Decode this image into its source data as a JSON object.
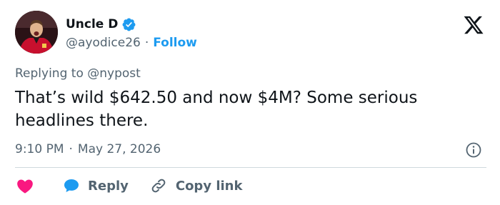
{
  "author": {
    "name": "Uncle D",
    "handle": "@ayodice26",
    "separator": "·",
    "follow_label": "Follow",
    "verified": true
  },
  "reply_context": "Replying to @nypost",
  "tweet_text": "That’s wild $642.50 and now $4M? Some serious headlines there.",
  "timestamp": {
    "time": "9:10 PM",
    "separator": "·",
    "date": "May 27, 2026"
  },
  "actions": {
    "like_icon": "heart-icon",
    "reply_label": "Reply",
    "copy_label": "Copy link"
  },
  "colors": {
    "accent": "#1d9bf0",
    "like": "#f91880",
    "muted": "#536471",
    "text": "#0f1419"
  }
}
